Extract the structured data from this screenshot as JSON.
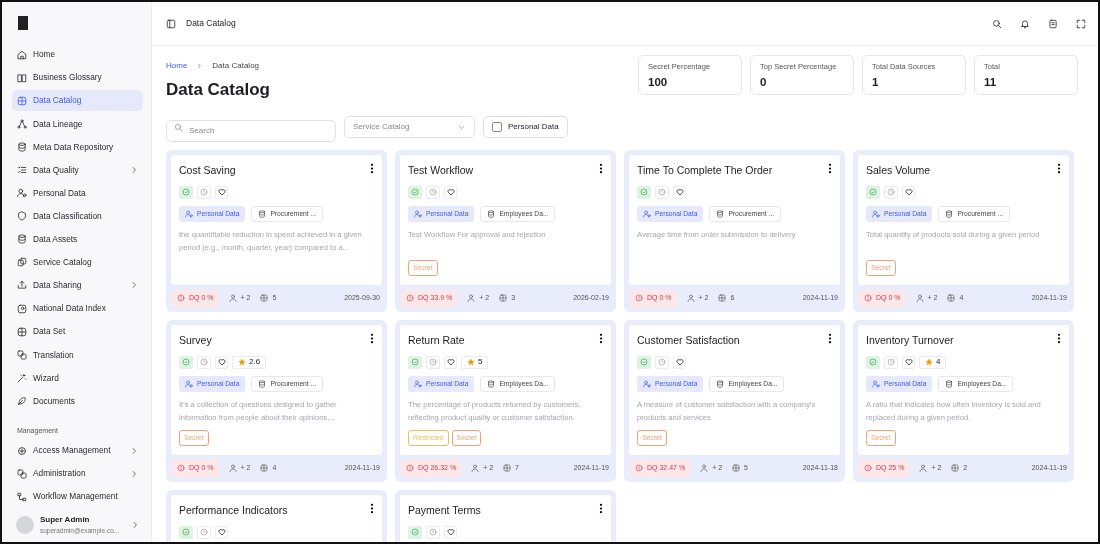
{
  "sidebar": {
    "items": [
      {
        "label": "Home",
        "selected": false,
        "expandable": false
      },
      {
        "label": "Business Glossary",
        "selected": false,
        "expandable": false
      },
      {
        "label": "Data Catalog",
        "selected": true,
        "expandable": false
      },
      {
        "label": "Data Lineage",
        "selected": false,
        "expandable": false
      },
      {
        "label": "Meta Data Repository",
        "selected": false,
        "expandable": false
      },
      {
        "label": "Data Quality",
        "selected": false,
        "expandable": true
      },
      {
        "label": "Personal Data",
        "selected": false,
        "expandable": false
      },
      {
        "label": "Data Classification",
        "selected": false,
        "expandable": false
      },
      {
        "label": "Data Assets",
        "selected": false,
        "expandable": false
      },
      {
        "label": "Service Catalog",
        "selected": false,
        "expandable": false
      },
      {
        "label": "Data Sharing",
        "selected": false,
        "expandable": true
      },
      {
        "label": "National Data Index",
        "selected": false,
        "expandable": false
      },
      {
        "label": "Data Set",
        "selected": false,
        "expandable": false
      },
      {
        "label": "Translation",
        "selected": false,
        "expandable": false
      },
      {
        "label": "Wizard",
        "selected": false,
        "expandable": false
      },
      {
        "label": "Documents",
        "selected": false,
        "expandable": false
      }
    ],
    "section_title": "Management",
    "management_items": [
      {
        "label": "Access Management",
        "selected": false,
        "expandable": true
      },
      {
        "label": "Administration",
        "selected": false,
        "expandable": true
      },
      {
        "label": "Workflow Management",
        "selected": false,
        "expandable": false
      }
    ],
    "user": {
      "name": "Super Admin",
      "email": "superadmin@example.co..."
    }
  },
  "topbar": {
    "title": "Data Catalog"
  },
  "breadcrumb": [
    {
      "label": "Home",
      "link": true
    },
    {
      "label": "Data Catalog",
      "link": false
    }
  ],
  "page_title": "Data Catalog",
  "stats": [
    {
      "label": "Secret Percentage",
      "value": "100"
    },
    {
      "label": "Top Secret Percentage",
      "value": "0"
    },
    {
      "label": "Total Data Sources",
      "value": "1"
    },
    {
      "label": "Total",
      "value": "11"
    }
  ],
  "filters": {
    "search": {
      "placeholder": "Search"
    },
    "select": {
      "placeholder": "Service Catalog"
    },
    "checkbox": {
      "label": "Personal Data",
      "checked": false
    }
  },
  "cards": [
    {
      "title": "Cost Saving",
      "tags": [
        {
          "kind": "personal",
          "label": "Personal Data"
        },
        {
          "kind": "source",
          "label": "Procurement ..."
        }
      ],
      "description": "the quantifiable reduction in spend achieved in a given period (e.g., month, quarter, year) compared to a...",
      "dq": "DQ 0 %",
      "people": "+ 2",
      "tables": "5",
      "date": "2025-09-30"
    },
    {
      "title": "Test Workflow",
      "tags": [
        {
          "kind": "personal",
          "label": "Personal Data"
        },
        {
          "kind": "source",
          "label": "Employees Da..."
        }
      ],
      "description": "Test Workflow For approval and rejection",
      "classifications": [
        {
          "label": "Secret",
          "color": "#f0a27a"
        }
      ],
      "dq": "DQ 33.9 %",
      "people": "+ 2",
      "tables": "3",
      "date": "2026-02-19"
    },
    {
      "title": "Time To Complete The Order",
      "tags": [
        {
          "kind": "personal",
          "label": "Personal Data"
        },
        {
          "kind": "source",
          "label": "Procurement ..."
        }
      ],
      "description": "Average time from order submission to delivery",
      "dq": "DQ 0 %",
      "people": "+ 2",
      "tables": "6",
      "date": "2024-11-19"
    },
    {
      "title": "Sales Volume",
      "tags": [
        {
          "kind": "personal",
          "label": "Personal Data"
        },
        {
          "kind": "source",
          "label": "Procurement ..."
        }
      ],
      "description": "Total quantity of products sold during a given period",
      "classifications": [
        {
          "label": "Secret",
          "color": "#f0a27a"
        }
      ],
      "dq": "DQ 0 %",
      "people": "+ 2",
      "tables": "4",
      "date": "2024-11-19"
    },
    {
      "title": "Survey",
      "rating": "2.6",
      "tags": [
        {
          "kind": "personal",
          "label": "Personal Data"
        },
        {
          "kind": "source",
          "label": "Procurement ..."
        }
      ],
      "description": "It's a collection of questions designed to gather information from people about their opinions,...",
      "classifications": [
        {
          "label": "Secret",
          "color": "#f0a27a"
        }
      ],
      "dq": "DQ 0 %",
      "people": "+ 2",
      "tables": "4",
      "date": "2024-11-19"
    },
    {
      "title": "Return Rate",
      "rating": "5",
      "tags": [
        {
          "kind": "personal",
          "label": "Personal Data"
        },
        {
          "kind": "source",
          "label": "Employees Da..."
        }
      ],
      "description": "The percentage of products returned by customers, reflecting product quality or customer satisfaction.",
      "classifications": [
        {
          "label": "Restricted",
          "color": "#e3c35a"
        },
        {
          "label": "Secret",
          "color": "#f0a27a"
        }
      ],
      "dq": "DQ 26.32 %",
      "people": "+ 2",
      "tables": "7",
      "date": "2024-11-19"
    },
    {
      "title": "Customer Satisfaction",
      "tags": [
        {
          "kind": "personal",
          "label": "Personal Data"
        },
        {
          "kind": "source",
          "label": "Employees Da..."
        }
      ],
      "description": "A measure of customer satisfaction with a company's products and services",
      "classifications": [
        {
          "label": "Secret",
          "color": "#f0a27a"
        }
      ],
      "dq": "DQ 32.47 %",
      "people": "+ 2",
      "tables": "5",
      "date": "2024-11-18"
    },
    {
      "title": "Inventory Turnover",
      "rating": "4",
      "tags": [
        {
          "kind": "personal",
          "label": "Personal Data"
        },
        {
          "kind": "source",
          "label": "Employees Da..."
        }
      ],
      "description": "A ratio that indicates how often inventory is sold and replaced during a given period.",
      "classifications": [
        {
          "label": "Secret",
          "color": "#f0a27a"
        }
      ],
      "dq": "DQ 25 %",
      "people": "+ 2",
      "tables": "2",
      "date": "2024-11-19"
    },
    {
      "title": "Performance Indicators"
    },
    {
      "title": "Payment Terms"
    }
  ]
}
